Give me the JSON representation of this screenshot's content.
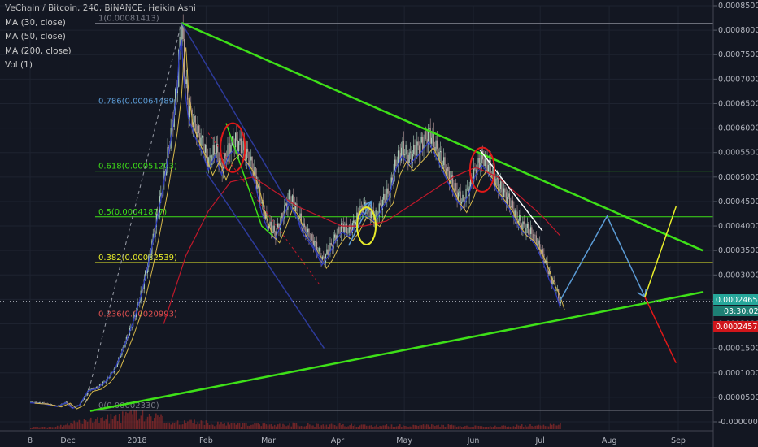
{
  "legend": {
    "title": "VeChain / Bitcoin, 240, BINANCE, Heikin Ashi",
    "ma30": "MA (30, close)",
    "ma50": "MA (50, close)",
    "ma200": "MA (200, close)",
    "vol": "Vol (1)"
  },
  "badges": {
    "last_price": "0.00024654",
    "countdown": "03:30:02",
    "ma_price": "0.00024579"
  },
  "colors": {
    "background": "#131722",
    "green_line": "#3ee018",
    "blue_line": "#5b9bd5",
    "red_ma": "#c0182a",
    "yellow_arrow": "#e8ec2a",
    "red_arrow": "#e01818"
  },
  "chart_data": {
    "type": "line",
    "ylim": [
      -0.0,
      0.00085
    ],
    "y_ticks": [
      "0.00085000",
      "0.00080000",
      "0.00075000",
      "0.00070000",
      "0.00065000",
      "0.00060000",
      "0.00055000",
      "0.00050000",
      "0.00045000",
      "0.00040000",
      "0.00035000",
      "0.00030000",
      "0.00025000",
      "0.00020000",
      "0.00015000",
      "0.00010000",
      "0.00005000",
      "-0.00000000"
    ],
    "x_ticks": [
      {
        "label": "8",
        "t": 0
      },
      {
        "label": "Dec",
        "t": 17
      },
      {
        "label": "2018",
        "t": 48
      },
      {
        "label": "Feb",
        "t": 79
      },
      {
        "label": "Mar",
        "t": 107
      },
      {
        "label": "Apr",
        "t": 138
      },
      {
        "label": "May",
        "t": 168
      },
      {
        "label": "Jun",
        "t": 199
      },
      {
        "label": "Jul",
        "t": 229
      },
      {
        "label": "Aug",
        "t": 260
      },
      {
        "label": "Sep",
        "t": 291
      }
    ],
    "fib_levels": [
      {
        "label": "1(0.00081413)",
        "value": 0.00081413,
        "color": "#787b86"
      },
      {
        "label": "0.786(0.00064489)",
        "value": 0.00064489,
        "color": "#5b9bd5"
      },
      {
        "label": "0.618(0.00051203)",
        "value": 0.00051203,
        "color": "#3ee018"
      },
      {
        "label": "0.5(0.00041877)",
        "value": 0.00041877,
        "color": "#3ee018"
      },
      {
        "label": "0.382(0.00032539)",
        "value": 0.00032539,
        "color": "#e8ec2a"
      },
      {
        "label": "0.236(0.00020993)",
        "value": 0.00020993,
        "color": "#e05050"
      },
      {
        "label": "0(0.00002330)",
        "value": 2.33e-05,
        "color": "#787b86"
      }
    ],
    "price": [
      [
        0,
        4e-05
      ],
      [
        6,
        3.8e-05
      ],
      [
        12,
        3.2e-05
      ],
      [
        16,
        4e-05
      ],
      [
        19,
        2.8e-05
      ],
      [
        22,
        3.5e-05
      ],
      [
        26,
        6.5e-05
      ],
      [
        30,
        7e-05
      ],
      [
        34,
        8.5e-05
      ],
      [
        38,
        0.00011
      ],
      [
        41,
        0.000145
      ],
      [
        44,
        0.00018
      ],
      [
        47,
        0.00022
      ],
      [
        50,
        0.00027
      ],
      [
        53,
        0.00033
      ],
      [
        56,
        0.0004
      ],
      [
        58,
        0.00045
      ],
      [
        60,
        0.0005
      ],
      [
        62,
        0.00056
      ],
      [
        64,
        0.00062
      ],
      [
        66,
        0.0007
      ],
      [
        67,
        0.00078
      ],
      [
        68,
        0.000805
      ],
      [
        69,
        0.00072
      ],
      [
        71,
        0.00064
      ],
      [
        74,
        0.0006
      ],
      [
        77,
        0.00057
      ],
      [
        80,
        0.00053
      ],
      [
        83,
        0.00056
      ],
      [
        86,
        0.00052
      ],
      [
        89,
        0.00056
      ],
      [
        92,
        0.000575
      ],
      [
        95,
        0.00056
      ],
      [
        98,
        0.00054
      ],
      [
        101,
        0.0005
      ],
      [
        104,
        0.00044
      ],
      [
        107,
        0.0004
      ],
      [
        110,
        0.000385
      ],
      [
        113,
        0.00042
      ],
      [
        116,
        0.00046
      ],
      [
        119,
        0.00044
      ],
      [
        122,
        0.0004
      ],
      [
        125,
        0.00038
      ],
      [
        128,
        0.00036
      ],
      [
        131,
        0.00033
      ],
      [
        134,
        0.00035
      ],
      [
        137,
        0.00038
      ],
      [
        140,
        0.0004
      ],
      [
        143,
        0.00039
      ],
      [
        146,
        0.00041
      ],
      [
        149,
        0.00044
      ],
      [
        152,
        0.00043
      ],
      [
        155,
        0.00042
      ],
      [
        158,
        0.00045
      ],
      [
        161,
        0.00047
      ],
      [
        164,
        0.00053
      ],
      [
        167,
        0.00056
      ],
      [
        170,
        0.00054
      ],
      [
        173,
        0.000555
      ],
      [
        176,
        0.00057
      ],
      [
        179,
        0.00059
      ],
      [
        182,
        0.00056
      ],
      [
        185,
        0.00053
      ],
      [
        188,
        0.0005
      ],
      [
        191,
        0.00047
      ],
      [
        194,
        0.00045
      ],
      [
        197,
        0.00048
      ],
      [
        200,
        0.00052
      ],
      [
        203,
        0.00054
      ],
      [
        206,
        0.00052
      ],
      [
        209,
        0.00049
      ],
      [
        212,
        0.00047
      ],
      [
        215,
        0.00045
      ],
      [
        218,
        0.00042
      ],
      [
        221,
        0.0004
      ],
      [
        224,
        0.00039
      ],
      [
        227,
        0.00037
      ],
      [
        230,
        0.00034
      ],
      [
        233,
        0.0003
      ],
      [
        236,
        0.00027
      ],
      [
        238,
        0.00024
      ]
    ],
    "ma200": [
      [
        60,
        0.0002
      ],
      [
        70,
        0.00034
      ],
      [
        80,
        0.00043
      ],
      [
        90,
        0.00049
      ],
      [
        100,
        0.0005
      ],
      [
        110,
        0.00047
      ],
      [
        120,
        0.00044
      ],
      [
        130,
        0.00042
      ],
      [
        140,
        0.0004
      ],
      [
        150,
        0.0004
      ],
      [
        160,
        0.00041
      ],
      [
        170,
        0.00044
      ],
      [
        180,
        0.00047
      ],
      [
        190,
        0.0005
      ],
      [
        200,
        0.00052
      ],
      [
        210,
        0.0005
      ],
      [
        220,
        0.00046
      ],
      [
        230,
        0.00042
      ],
      [
        238,
        0.00038
      ]
    ],
    "volume": [
      [
        0,
        2
      ],
      [
        10,
        2
      ],
      [
        20,
        8
      ],
      [
        30,
        10
      ],
      [
        40,
        14
      ],
      [
        45,
        18
      ],
      [
        50,
        16
      ],
      [
        55,
        14
      ],
      [
        60,
        12
      ],
      [
        65,
        10
      ],
      [
        70,
        9
      ],
      [
        80,
        7
      ],
      [
        90,
        6
      ],
      [
        100,
        5
      ],
      [
        110,
        5
      ],
      [
        120,
        6
      ],
      [
        130,
        5
      ],
      [
        140,
        5
      ],
      [
        150,
        4
      ],
      [
        160,
        4
      ],
      [
        170,
        4
      ],
      [
        180,
        4
      ],
      [
        190,
        4
      ],
      [
        200,
        3
      ],
      [
        210,
        3
      ],
      [
        220,
        4
      ],
      [
        230,
        4
      ],
      [
        238,
        5
      ]
    ],
    "lines": [
      {
        "name": "upper-trendline",
        "color": "#3ee018",
        "width": 2.5,
        "pts": [
          [
            68,
            0.000815
          ],
          [
            302,
            0.00035
          ]
        ]
      },
      {
        "name": "lower-trendline",
        "color": "#3ee018",
        "width": 2.5,
        "pts": [
          [
            27,
            2.2e-05
          ],
          [
            302,
            0.000265
          ]
        ]
      },
      {
        "name": "channel-upper",
        "color": "#2d3a9a",
        "width": 1.5,
        "pts": [
          [
            68,
            0.000815
          ],
          [
            132,
            0.000322
          ]
        ]
      },
      {
        "name": "channel-lower",
        "color": "#2d3a9a",
        "width": 1.5,
        "pts": [
          [
            79,
            0.00051
          ],
          [
            132,
            0.00015
          ]
        ]
      },
      {
        "name": "red-dotted",
        "color": "#c0182a",
        "width": 1,
        "dash": "3,3",
        "pts": [
          [
            80,
            0.00059
          ],
          [
            130,
            0.00028
          ]
        ]
      },
      {
        "name": "white-dotted",
        "color": "#9a9ea8",
        "width": 1,
        "dash": "4,4",
        "pts": [
          [
            25,
            4e-05
          ],
          [
            68,
            0.000815
          ]
        ]
      },
      {
        "name": "white-trendline",
        "color": "#ffffff",
        "width": 1.5,
        "pts": [
          [
            202,
            0.000555
          ],
          [
            230,
            0.00039
          ]
        ]
      },
      {
        "name": "green-hatch",
        "color": "#3ee018",
        "width": 1.5,
        "pts": [
          [
            88,
            0.00061
          ],
          [
            104,
            0.0004
          ],
          [
            109,
            0.00038
          ]
        ]
      },
      {
        "name": "blue-projection",
        "color": "#5b9bd5",
        "width": 1.5,
        "pts": [
          [
            238,
            0.000248
          ],
          [
            259,
            0.00042
          ],
          [
            276,
            0.000255
          ]
        ],
        "arrow": true
      },
      {
        "name": "blue-short-arrow",
        "color": "#5b9bd5",
        "width": 1.5,
        "pts": [
          [
            143,
            0.00036
          ],
          [
            153,
            0.00045
          ]
        ],
        "arrow": true
      },
      {
        "name": "yellow-projection",
        "color": "#e8ec2a",
        "width": 1.5,
        "pts": [
          [
            276,
            0.000255
          ],
          [
            290,
            0.00044
          ]
        ],
        "arrow": false
      },
      {
        "name": "red-projection",
        "color": "#e01818",
        "width": 1.5,
        "pts": [
          [
            276,
            0.000255
          ],
          [
            290,
            0.00012
          ]
        ],
        "arrow": false
      }
    ],
    "ellipses": [
      {
        "name": "red-circle-1",
        "color": "#e01818",
        "t": 91,
        "v": 0.00056,
        "rt": 5.5,
        "rv": 5e-05
      },
      {
        "name": "yellow-circle",
        "color": "#e8ec2a",
        "t": 151,
        "v": 0.0004,
        "rt": 4.2,
        "rv": 3.8e-05
      },
      {
        "name": "red-circle-2",
        "color": "#e01818",
        "t": 203,
        "v": 0.000515,
        "rt": 5.5,
        "rv": 4.5e-05
      }
    ]
  }
}
